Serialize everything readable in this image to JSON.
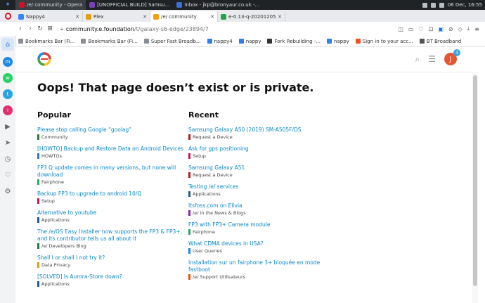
{
  "taskbar": {
    "tasks": [
      {
        "label": "/e/ community - Opera",
        "color": "#d0112b",
        "active": true
      },
      {
        "label": "[UNOFFICIAL BUILD] Samsu...",
        "color": "#7a3fbf",
        "active": false
      },
      {
        "label": "Inbox - jkp@bronyaur.co.uk -...",
        "color": "#3a6fd8",
        "active": false
      }
    ],
    "clock": "06 Dec, 16:55"
  },
  "browser_tabs": [
    {
      "label": "Nappy4",
      "color": "#3b82f6",
      "active": false
    },
    {
      "label": "Plex",
      "color": "#e5a00d",
      "active": false
    },
    {
      "label": "/e/ community",
      "color": "#f59e0b",
      "active": true
    },
    {
      "label": "e-0.13-q-20201205-UNOF",
      "color": "#22a34a",
      "active": false
    }
  ],
  "address": {
    "host": "community.e.foundation",
    "path": "/t/galaxy-s6-edge/23894/7"
  },
  "bookmarks": [
    {
      "label": "Bookmarks Bar (Fi...",
      "color": "#8a8f96"
    },
    {
      "label": "Bookmarks Bar (Fi...",
      "color": "#8a8f96"
    },
    {
      "label": "Super Fast Broadb...",
      "color": "#8a8f96"
    },
    {
      "label": "nappy4",
      "color": "#2f80ed"
    },
    {
      "label": "nappy",
      "color": "#2f80ed"
    },
    {
      "label": "Fork Rebuilding -...",
      "color": "#333333"
    },
    {
      "label": "nappy",
      "color": "#2f80ed"
    },
    {
      "label": "Sign in to your acc...",
      "color": "#f25022"
    },
    {
      "label": "BT Broadband",
      "color": "#555555"
    }
  ],
  "sidebar": {
    "items": [
      {
        "icon": "home-icon",
        "glyph": "⌂",
        "color": "#2c6ed6"
      },
      {
        "icon": "messenger-icon",
        "glyph": "m",
        "color": "#1e88e5"
      },
      {
        "icon": "whatsapp-icon",
        "glyph": "w",
        "color": "#25d366"
      },
      {
        "icon": "telegram-icon",
        "glyph": "t",
        "color": "#2aa3df"
      },
      {
        "icon": "instagram-icon",
        "glyph": "i",
        "color": "#e1306c"
      },
      {
        "icon": "player-icon",
        "glyph": "▶",
        "color": "#666666"
      },
      {
        "icon": "send-icon",
        "glyph": "➤",
        "color": "#666666"
      },
      {
        "icon": "history-icon",
        "glyph": "◷",
        "color": "#666666"
      },
      {
        "icon": "heart-icon",
        "glyph": "♡",
        "color": "#666666"
      },
      {
        "icon": "settings-icon",
        "glyph": "⚙",
        "color": "#666666"
      }
    ]
  },
  "site": {
    "avatar_letter": "J",
    "notification_count": "3"
  },
  "error_title": "Oops! That page doesn’t exist or is private.",
  "popular": {
    "heading": "Popular",
    "topics": [
      {
        "title": "Please stop calling Google “goolag”",
        "category": "Community",
        "color": "#2e7d32"
      },
      {
        "title": "[HOWTO] Backup and Restore Data on Android Devices",
        "category": "HOWTOs",
        "color": "#2a7ab7"
      },
      {
        "title": "FP3 Q update comes in many versions, but none will download",
        "category": "Fairphone",
        "color": "#25a86a"
      },
      {
        "title": "Backup FP3 to upgrade to android 10/Q",
        "category": "Setup",
        "color": "#c2185b"
      },
      {
        "title": "Alternative to youtube",
        "category": "Applications",
        "color": "#1a5c8a"
      },
      {
        "title": "The /e/OS Easy Installer now supports the FP3 & FP3+, and its contributor tells us all about it",
        "category": "/e/ Developers Blog",
        "color": "#1f7a4a"
      },
      {
        "title": "Shall I or shall I not try it?",
        "category": "Data Privacy",
        "color": "#d6a400"
      },
      {
        "title": "[SOLVED] Is Aurora-Store down?",
        "category": "Applications",
        "color": "#1a5c8a"
      }
    ]
  },
  "recent": {
    "heading": "Recent",
    "topics": [
      {
        "title": "Samsung Galaxy A50 (2019) SM-A505F/DS",
        "category": "Request a Device",
        "color": "#b71c1c"
      },
      {
        "title": "Ask for gps positioning",
        "category": "Setup",
        "color": "#c2185b"
      },
      {
        "title": "Samsung Galaxy A51",
        "category": "Request a Device",
        "color": "#b71c1c"
      },
      {
        "title": "Testing /e/ services",
        "category": "Applications",
        "color": "#1a5c8a"
      },
      {
        "title": "Itsfoss.com on Elivia",
        "category": "/e/ in the News & Blogs",
        "color": "#8e24aa"
      },
      {
        "title": "FP3 with FP3+ Camera module",
        "category": "Fairphone",
        "color": "#25a86a"
      },
      {
        "title": "What CDMA devices in USA?",
        "category": "User Queries",
        "color": "#1e88e5"
      },
      {
        "title": "Installation sur un fairphone 3+ bloquée en mode fastboot",
        "category": "/e/ Support Utilisateurs",
        "color": "#e65100"
      }
    ]
  }
}
